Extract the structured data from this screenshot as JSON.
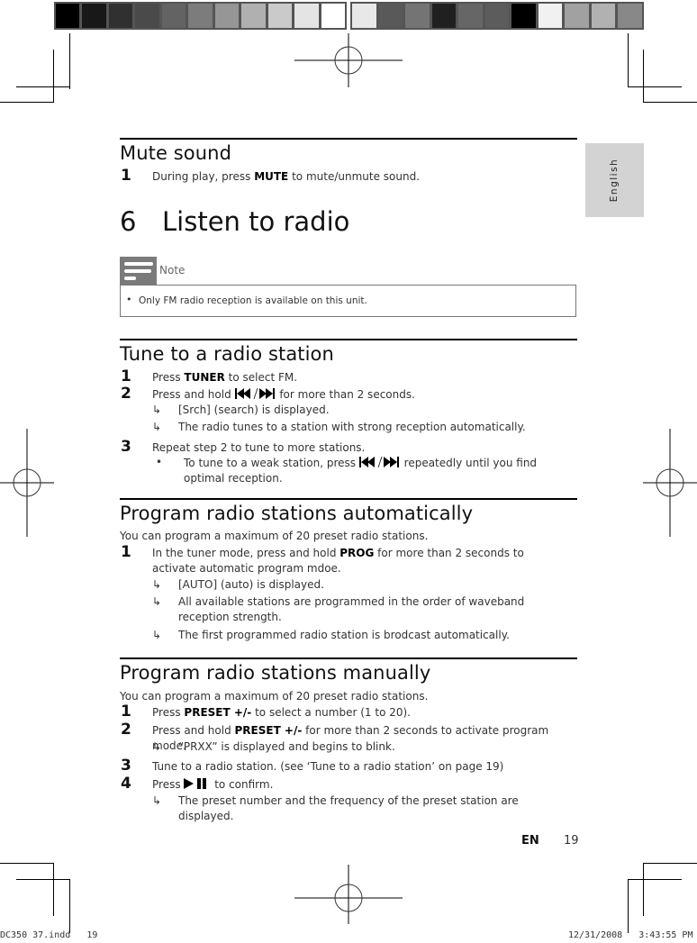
{
  "colorbars": {
    "left": [
      "#000000",
      "#181818",
      "#303030",
      "#4a4a4a",
      "#636363",
      "#7c7c7c",
      "#969696",
      "#b0b0b0",
      "#cacaca",
      "#e4e4e4",
      "#ffffff"
    ],
    "right": [
      "#e8e8e8",
      "#595959",
      "#747474",
      "#202020",
      "#666666",
      "#5c5c5c",
      "#000000",
      "#f1f1f1",
      "#a1a1a1",
      "#b1b1b1",
      "#888888"
    ]
  },
  "side_tab": {
    "label": "English"
  },
  "mute": {
    "title": "Mute sound",
    "steps": [
      {
        "num": "1",
        "before": "During play, press ",
        "key": "MUTE",
        "after": " to mute/unmute sound."
      }
    ]
  },
  "chapter": {
    "number": "6",
    "title": "Listen to radio"
  },
  "note": {
    "label": "Note",
    "bullet": "•",
    "text": "Only FM radio reception is available on this unit."
  },
  "tune": {
    "title": "Tune to a radio station",
    "step1": {
      "num": "1",
      "before": "Press ",
      "key": "TUNER",
      "after": " to select FM."
    },
    "step2": {
      "num": "2",
      "before": "Press and hold ",
      "after": " for more than 2 seconds.",
      "icon": "prev-next-icon"
    },
    "step2_results": [
      "[Srch] (search) is displayed.",
      "The radio tunes to a station with strong reception automatically."
    ],
    "step3": {
      "num": "3",
      "text": "Repeat step 2 to tune to more stations."
    },
    "step3_bullet": {
      "bullet": "•",
      "before": "To tune to a weak station, press ",
      "after": " repeatedly until you find optimal reception."
    }
  },
  "auto": {
    "title": "Program radio stations automatically",
    "intro": "You can program a maximum of 20 preset radio stations.",
    "step1": {
      "num": "1",
      "before": "In the tuner mode, press and hold ",
      "key": "PROG",
      "after": " for more than 2 seconds to activate automatic program mdoe."
    },
    "results": [
      "[AUTO] (auto) is displayed.",
      "All available stations are programmed in the order of waveband reception strength.",
      "The first programmed radio station is brodcast automatically."
    ]
  },
  "manual": {
    "title": "Program radio stations manually",
    "intro": "You can program a maximum of 20 preset radio stations.",
    "step1": {
      "num": "1",
      "before": "Press ",
      "key": "PRESET +/-",
      "after": " to select a number (1 to 20)."
    },
    "step2": {
      "num": "2",
      "before": "Press and hold ",
      "key": "PRESET +/-",
      "after": " for more than 2 seconds to activate program mode."
    },
    "step2_result": "“PRXX” is displayed and begins to blink.",
    "step3": {
      "num": "3",
      "text": "Tune to a radio station. (see ‘Tune to a radio station’ on page 19)"
    },
    "step4": {
      "num": "4",
      "before": "Press ",
      "after": " to confirm.",
      "icon": "play-pause-icon"
    },
    "step4_result": "The preset number and the frequency of the preset station are displayed."
  },
  "arrow_glyph": "↳",
  "footer": {
    "lang": "EN",
    "page": "19"
  },
  "slug": {
    "file": "DC350 37.indd   19",
    "timestamp": "12/31/2008   3:43:55 PM"
  }
}
